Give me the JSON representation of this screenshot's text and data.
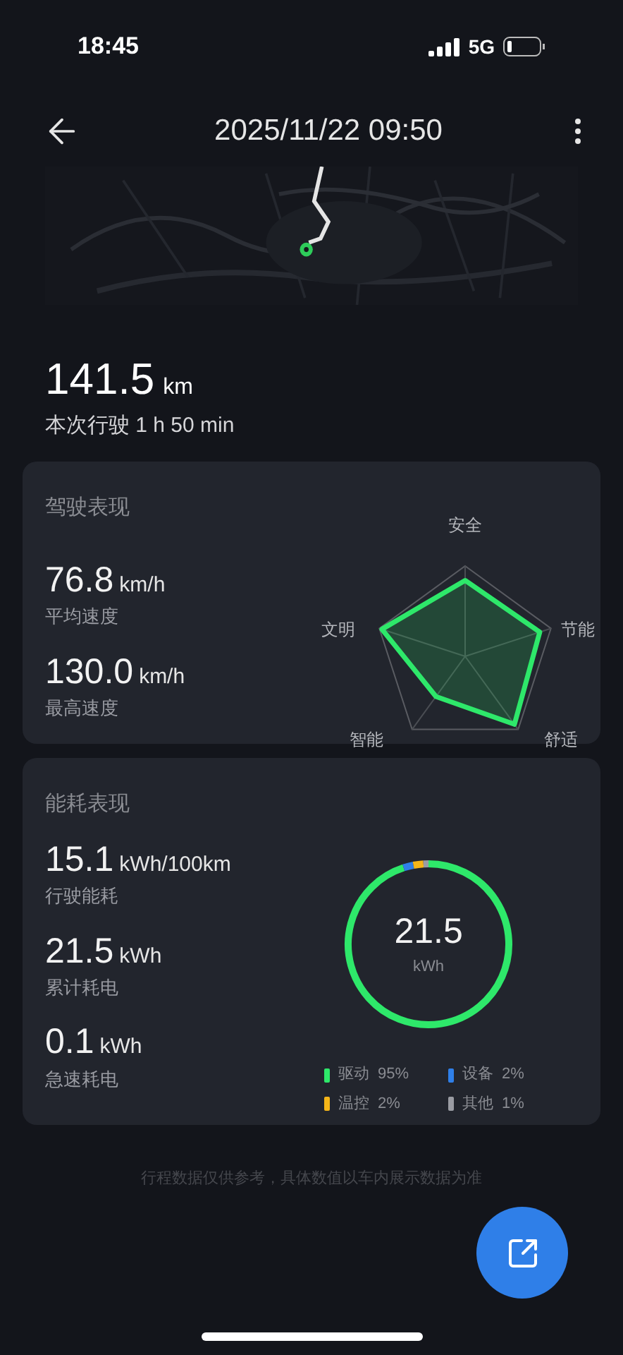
{
  "status_bar": {
    "time": "18:45",
    "network": "5G"
  },
  "header": {
    "title": "2025/11/22 09:50"
  },
  "trip": {
    "distance": "141.5",
    "distance_unit": "km",
    "duration": "本次行驶 1 h 50 min"
  },
  "driving": {
    "title": "驾驶表现",
    "stats": [
      {
        "value": "76.8",
        "unit": "km/h",
        "label": "平均速度"
      },
      {
        "value": "130.0",
        "unit": "km/h",
        "label": "最高速度"
      }
    ],
    "radar": {
      "axes": [
        "安全",
        "节能",
        "舒适",
        "智能",
        "文明"
      ]
    }
  },
  "energy": {
    "title": "能耗表现",
    "stats": [
      {
        "value": "15.1",
        "unit": "kWh/100km",
        "label": "行驶能耗"
      },
      {
        "value": "21.5",
        "unit": "kWh",
        "label": "累计耗电"
      },
      {
        "value": "0.1",
        "unit": "kWh",
        "label": "急速耗电"
      }
    ],
    "total": {
      "value": "21.5",
      "unit": "kWh"
    },
    "legend": [
      {
        "label": "驱动",
        "percent": "95%",
        "color": "#2ee86a"
      },
      {
        "label": "设备",
        "percent": "2%",
        "color": "#2f7fe8"
      },
      {
        "label": "温控",
        "percent": "2%",
        "color": "#f5b518"
      },
      {
        "label": "其他",
        "percent": "1%",
        "color": "#9a9ca3"
      }
    ]
  },
  "footer": {
    "note": "行程数据仅供参考，具体数值以车内展示数据为准"
  }
}
